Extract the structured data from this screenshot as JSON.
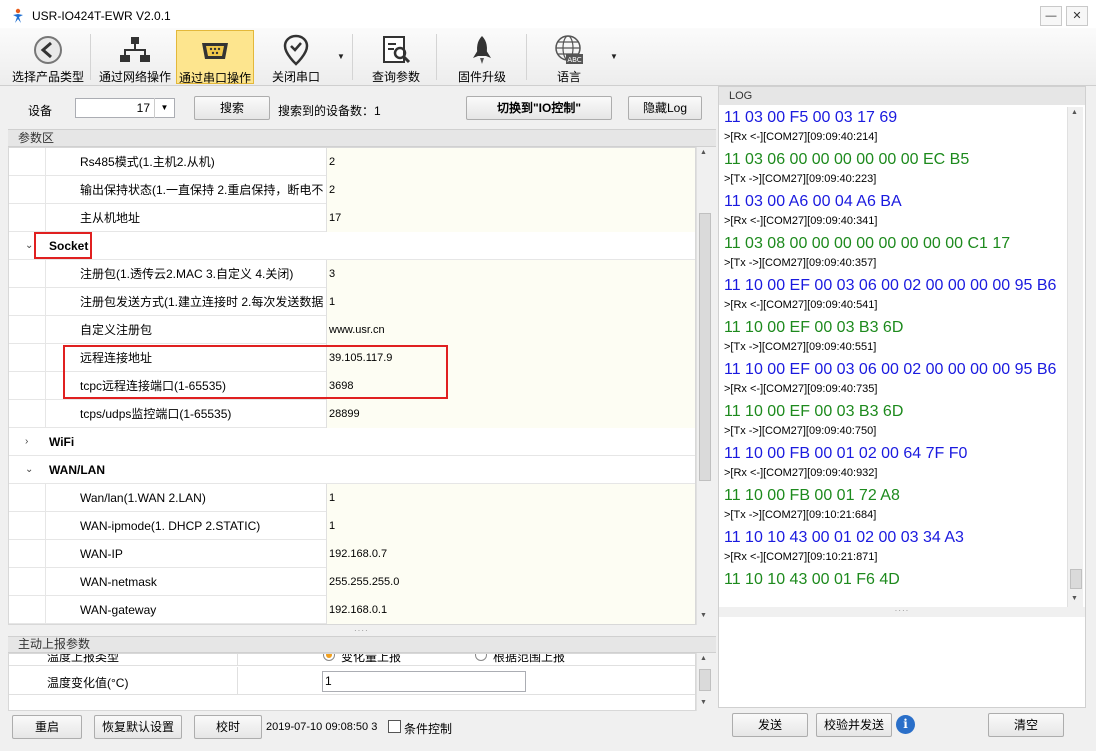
{
  "window": {
    "title": "USR-IO424T-EWR V2.0.1"
  },
  "toolbar": {
    "items": [
      {
        "label": "选择产品类型",
        "icon": "back-arrow-icon"
      },
      {
        "label": "通过网络操作",
        "icon": "network-icon"
      },
      {
        "label": "通过串口操作",
        "icon": "serial-port-icon",
        "active": true
      },
      {
        "label": "关闭串口",
        "icon": "location-check-icon"
      },
      {
        "label": "查询参数",
        "icon": "search-document-icon"
      },
      {
        "label": "固件升级",
        "icon": "rocket-icon"
      },
      {
        "label": "语言",
        "icon": "globe-abc-icon"
      }
    ]
  },
  "device_bar": {
    "device_label": "设备",
    "device_value": "17",
    "search_label": "搜索",
    "found_text": "搜索到的设备数：1",
    "switch_label": "切换到\"IO控制\"",
    "hide_log_label": "隐藏Log"
  },
  "params": {
    "section_title": "参数区",
    "rows": [
      {
        "label": "Rs485模式(1.主机2.从机)",
        "value": "2"
      },
      {
        "label": "输出保持状态(1.一直保持 2.重启保持，断电不",
        "value": "2"
      },
      {
        "label": "主从机地址",
        "value": "17"
      },
      {
        "category": "Socket"
      },
      {
        "label": "注册包(1.透传云2.MAC 3.自定义 4.关闭)",
        "value": "3"
      },
      {
        "label": "注册包发送方式(1.建立连接时 2.每次发送数据",
        "value": "1"
      },
      {
        "label": "自定义注册包",
        "value": "www.usr.cn"
      },
      {
        "label": "远程连接地址",
        "value": "39.105.117.9"
      },
      {
        "label": "tcpc远程连接端口(1-65535)",
        "value": "3698"
      },
      {
        "label": "tcps/udps监控端口(1-65535)",
        "value": "28899"
      },
      {
        "category": "WiFi",
        "collapsed": true
      },
      {
        "category": "WAN/LAN"
      },
      {
        "label": "Wan/lan(1.WAN 2.LAN)",
        "value": "1"
      },
      {
        "label": "WAN-ipmode(1. DHCP 2.STATIC)",
        "value": "1"
      },
      {
        "label": "WAN-IP",
        "value": "192.168.0.7"
      },
      {
        "label": "WAN-netmask",
        "value": "255.255.255.0"
      },
      {
        "label": "WAN-gateway",
        "value": "192.168.0.1"
      }
    ]
  },
  "report": {
    "section_title": "主动上报参数",
    "type_label": "温度上报类型",
    "radio_change": "变化量上报",
    "radio_range": "根据范围上报",
    "change_label": "温度变化值(°C)",
    "change_value": "1"
  },
  "footer": {
    "restart": "重启",
    "restore": "恢复默认设置",
    "sync_time": "校时",
    "datetime": "2019-07-10 09:08:50 3",
    "condition": "条件控制"
  },
  "log": {
    "title": "LOG",
    "lines": [
      {
        "t": "data",
        "c": "blue",
        "text": "11 03 00 F5 00 03 17 69"
      },
      {
        "t": "meta",
        "text": ">[Rx <-][COM27][09:09:40:214]"
      },
      {
        "t": "data",
        "c": "green",
        "text": "11 03 06 00 00 00 00 00 00 EC B5"
      },
      {
        "t": "meta",
        "text": ">[Tx ->][COM27][09:09:40:223]"
      },
      {
        "t": "data",
        "c": "blue",
        "text": "11 03 00 A6 00 04 A6 BA"
      },
      {
        "t": "meta",
        "text": ">[Rx <-][COM27][09:09:40:341]"
      },
      {
        "t": "data",
        "c": "green",
        "text": "11 03 08 00 00 00 00 00 00 00 00 C1 17"
      },
      {
        "t": "meta",
        "text": ">[Tx ->][COM27][09:09:40:357]"
      },
      {
        "t": "data",
        "c": "blue",
        "text": "11 10 00 EF 00 03 06 00 02 00 00 00 00 95 B6"
      },
      {
        "t": "meta",
        "text": ">[Rx <-][COM27][09:09:40:541]"
      },
      {
        "t": "data",
        "c": "green",
        "text": "11 10 00 EF 00 03 B3 6D"
      },
      {
        "t": "meta",
        "text": ">[Tx ->][COM27][09:09:40:551]"
      },
      {
        "t": "data",
        "c": "blue",
        "text": "11 10 00 EF 00 03 06 00 02 00 00 00 00 95 B6"
      },
      {
        "t": "meta",
        "text": ">[Rx <-][COM27][09:09:40:735]"
      },
      {
        "t": "data",
        "c": "green",
        "text": "11 10 00 EF 00 03 B3 6D"
      },
      {
        "t": "meta",
        "text": ">[Tx ->][COM27][09:09:40:750]"
      },
      {
        "t": "data",
        "c": "blue",
        "text": "11 10 00 FB 00 01 02 00 64 7F F0"
      },
      {
        "t": "meta",
        "text": ">[Rx <-][COM27][09:09:40:932]"
      },
      {
        "t": "data",
        "c": "green",
        "text": "11 10 00 FB 00 01 72 A8"
      },
      {
        "t": "meta",
        "text": ">[Tx ->][COM27][09:10:21:684]"
      },
      {
        "t": "data",
        "c": "blue",
        "text": "11 10 10 43 00 01 02 00 03 34 A3"
      },
      {
        "t": "meta",
        "text": ">[Rx <-][COM27][09:10:21:871]"
      },
      {
        "t": "data",
        "c": "green",
        "text": "11 10 10 43 00 01 F6 4D"
      }
    ],
    "send": "发送",
    "check_send": "校验并发送",
    "clear": "清空"
  }
}
